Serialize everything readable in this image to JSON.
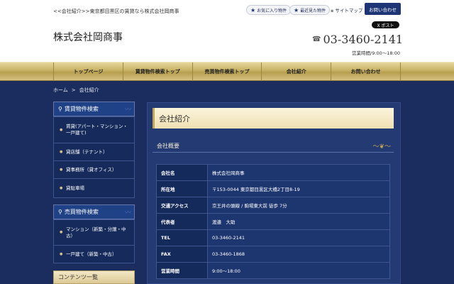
{
  "header": {
    "tagline": "<<会社紹介>>東京都目黒区の賃貸なら株式会社岡商事",
    "company_name": "株式会社岡商事",
    "favorites_label": "お気に入り物件",
    "recent_label": "最近見た物件",
    "sitemap_label": "サイトマップ",
    "contact_button": "お問い合わせ",
    "x_post": "X ポスト",
    "phone": "03-3460-2141",
    "hours": "営業時間/9:00〜18:00"
  },
  "nav": {
    "items": [
      "トップページ",
      "賃貸物件検索トップ",
      "売買物件検索トップ",
      "会社紹介",
      "お問い合わせ"
    ]
  },
  "breadcrumb": {
    "home": "ホーム",
    "sep": ">",
    "current": "会社紹介"
  },
  "sidebar": {
    "rental_title": "賃貸物件検索",
    "rental_items": [
      "賃貸(アパート・マンション・一戸建て)",
      "貸店舗（テナント）",
      "貸事務所（貸オフィス）",
      "貸駐車場"
    ],
    "sale_title": "売買物件検索",
    "sale_items": [
      "マンション（新築・分譲・中古）",
      "一戸建て（新築・中古）"
    ],
    "contents_title": "コンテンツ一覧"
  },
  "main": {
    "title": "会社紹介",
    "section_title": "会社概要",
    "table": [
      {
        "label": "会社名",
        "value": "株式会社岡商事"
      },
      {
        "label": "所在地",
        "value": "〒153-0044 東京都目黒区大橋2丁目8-19"
      },
      {
        "label": "交通アクセス",
        "value": "京王井の頭線 / 駒場東大前 徒歩 7分"
      },
      {
        "label": "代表者",
        "value": "渡邉　大助"
      },
      {
        "label": "TEL",
        "value": "03-3460-2141"
      },
      {
        "label": "FAX",
        "value": "03-3460-1868"
      },
      {
        "label": "営業時間",
        "value": "9:00〜18:00"
      }
    ]
  },
  "colors": {
    "background": "#1b2d5e",
    "accent": "#1d3575",
    "gold": "#c7b164"
  }
}
